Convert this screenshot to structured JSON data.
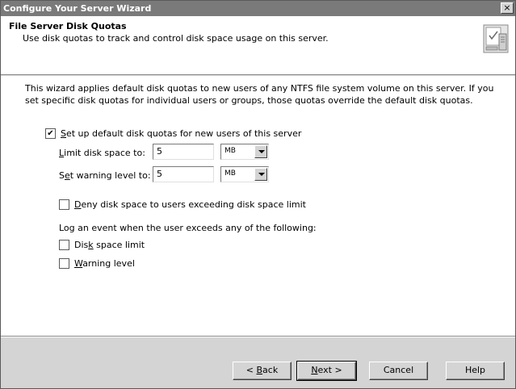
{
  "window": {
    "title": "Configure Your Server Wizard",
    "close_symbol": "×"
  },
  "header": {
    "title": "File Server Disk Quotas",
    "subtitle": "Use disk quotas to track and control disk space usage on this server.",
    "icon": "server-disk-quota-icon"
  },
  "content": {
    "intro": "This wizard applies default disk quotas to new users of any NTFS file system volume on this server. If you set specific disk quotas for individual users or groups, those quotas override the default disk quotas.",
    "default_quotas": {
      "checked": true,
      "label_key": "S",
      "label_rest": "et up default disk quotas for new users of this server"
    },
    "limit": {
      "label_key": "L",
      "label_rest": "imit disk space to:",
      "value": "5",
      "unit": "MB"
    },
    "warning": {
      "label_pre": "S",
      "label_key": "e",
      "label_rest": "t warning level to:",
      "value": "5",
      "unit": "MB"
    },
    "deny": {
      "checked": false,
      "label_key": "D",
      "label_rest": "eny disk space to users exceeding disk space limit"
    },
    "log_label": "Log an event when the user exceeds any of the following:",
    "log_disk_limit": {
      "checked": false,
      "label_pre": "Dis",
      "label_key": "k",
      "label_rest": " space limit"
    },
    "log_warning": {
      "checked": false,
      "label_key": "W",
      "label_rest": "arning level"
    }
  },
  "buttons": {
    "back": {
      "pre": "< ",
      "key": "B",
      "rest": "ack"
    },
    "next": {
      "key": "N",
      "rest": "ext >"
    },
    "cancel": "Cancel",
    "help": "Help"
  }
}
